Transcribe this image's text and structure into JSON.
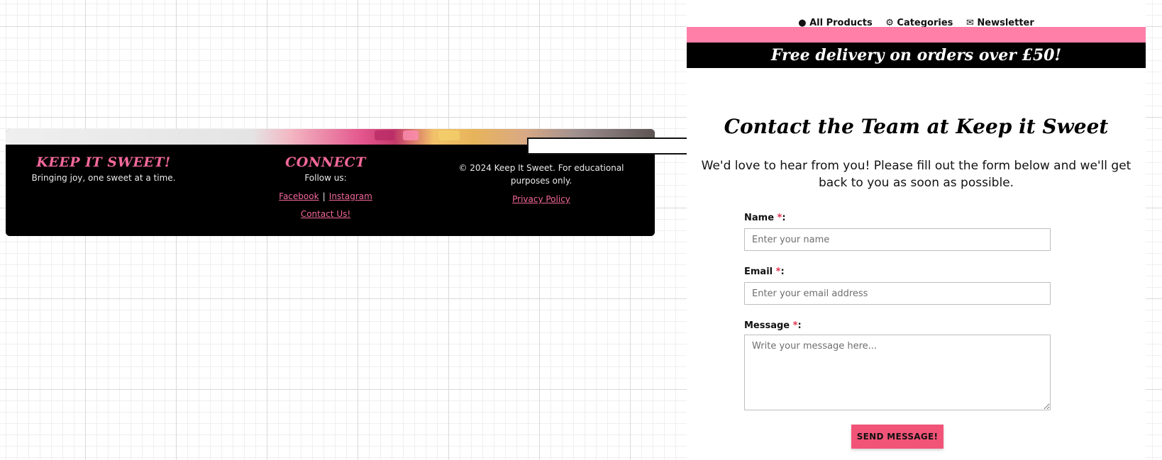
{
  "footer": {
    "brand": {
      "heading": "KEEP IT SWEET!",
      "tagline": "Bringing joy, one sweet at a time."
    },
    "connect": {
      "heading": "CONNECT",
      "follow_label": "Follow us:",
      "links": {
        "facebook": "Facebook",
        "separator": "|",
        "instagram": "Instagram",
        "contact": "Contact Us!"
      }
    },
    "legal": {
      "copyright": "© 2024 Keep It Sweet. For educational purposes only.",
      "privacy_link": "Privacy Policy"
    }
  },
  "contact_page": {
    "nav": {
      "items": [
        "All Products",
        "Categories",
        "Newsletter"
      ]
    },
    "promo_banner": "Free delivery on orders over £50!",
    "title": "Contact the Team at Keep it Sweet",
    "intro": "We'd love to hear from you! Please fill out the form below and we'll get back to you as soon as possible.",
    "form": {
      "required_marker": "*",
      "name": {
        "label": "Name",
        "placeholder": "Enter your name"
      },
      "email": {
        "label": "Email",
        "placeholder": "Enter your email address"
      },
      "message": {
        "label": "Message",
        "placeholder": "Write your message here..."
      },
      "submit_label": "SEND MESSAGE!"
    }
  },
  "colors": {
    "accent_pink": "#f3689a",
    "pink_bar": "#ff7fa8",
    "button_pink": "#f25478",
    "required_red": "#e0304e"
  },
  "icons": [
    "arrow-right-icon",
    "shop-icon",
    "categories-icon",
    "newsletter-icon"
  ]
}
